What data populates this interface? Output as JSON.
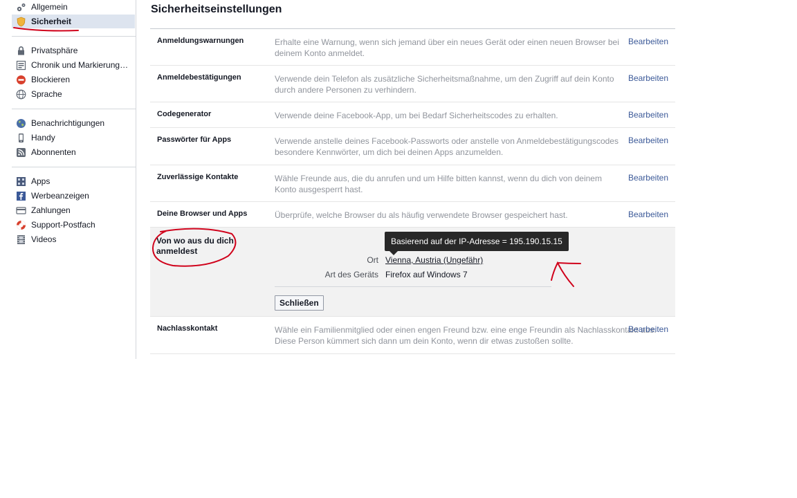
{
  "sidebar": {
    "items": [
      {
        "label": "Allgemein",
        "icon": "gears-icon"
      },
      {
        "label": "Sicherheit",
        "icon": "shield-icon",
        "active": true
      },
      {
        "label": "Privatsphäre",
        "icon": "lock-icon"
      },
      {
        "label": "Chronik und Markierung…",
        "icon": "timeline-icon"
      },
      {
        "label": "Blockieren",
        "icon": "block-icon"
      },
      {
        "label": "Sprache",
        "icon": "globe-icon"
      },
      {
        "label": "Benachrichtigungen",
        "icon": "world-icon"
      },
      {
        "label": "Handy",
        "icon": "phone-icon"
      },
      {
        "label": "Abonnenten",
        "icon": "rss-icon"
      },
      {
        "label": "Apps",
        "icon": "apps-icon"
      },
      {
        "label": "Werbeanzeigen",
        "icon": "facebook-ads-icon"
      },
      {
        "label": "Zahlungen",
        "icon": "card-icon"
      },
      {
        "label": "Support-Postfach",
        "icon": "lifebuoy-icon"
      },
      {
        "label": "Videos",
        "icon": "film-icon"
      }
    ]
  },
  "main": {
    "title": "Sicherheitseinstellungen",
    "edit_label": "Bearbeiten",
    "rows": [
      {
        "label": "Anmeldungswarnungen",
        "desc": "Erhalte eine Warnung, wenn sich jemand über ein neues Gerät oder einen neuen Browser bei deinem Konto anmeldet."
      },
      {
        "label": "Anmeldebestätigungen",
        "desc": "Verwende dein Telefon als zusätzliche Sicherheitsmaßnahme, um den Zugriff auf dein Konto durch andere Personen zu verhindern."
      },
      {
        "label": "Codegenerator",
        "desc": "Verwende deine Facebook-App, um bei Bedarf Sicherheitscodes zu erhalten."
      },
      {
        "label": "Passwörter für Apps",
        "desc": "Verwende anstelle deines Facebook-Passworts oder anstelle von Anmeldebestätigungscodes besondere Kennwörter, um dich bei deinen Apps anzumelden."
      },
      {
        "label": "Zuverlässige Kontakte",
        "desc": "Wähle Freunde aus, die du anrufen und um Hilfe bitten kannst, wenn du dich von deinem Konto ausgesperrt hast."
      },
      {
        "label": "Deine Browser und Apps",
        "desc": "Überprüfe, welche Browser du als häufig verwendete Browser gespeichert hast."
      }
    ],
    "expanded": {
      "label": "Von wo aus du dich anmeldest",
      "tooltip": "Basierend auf der IP-Adresse = 195.190.15.15",
      "location_key": "Ort",
      "location_value": "Vienna, Austria (Ungefähr)",
      "device_key": "Art des Geräts",
      "device_value": "Firefox auf Windows 7",
      "close_label": "Schließen"
    },
    "last_row": {
      "label": "Nachlasskontakt",
      "desc": "Wähle ein Familienmitglied oder einen engen Freund bzw. eine enge Freundin als Nachlasskontakt aus. Diese Person kümmert sich dann um dein Konto, wenn dir etwas zustoßen sollte."
    }
  },
  "colors": {
    "link": "#3b5998",
    "annotation": "#d0021b",
    "active_bg": "#dde4ef"
  }
}
